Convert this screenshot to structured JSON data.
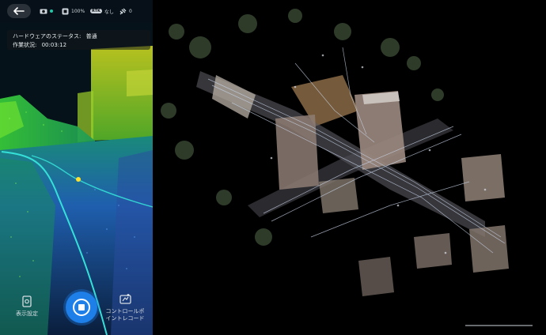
{
  "topbar": {
    "back_icon": "arrow-left-icon",
    "camera_icon": "camera-icon",
    "camera_dot_color": "#1ec9a8",
    "storage_icon": "storage-icon",
    "storage_value": "100%",
    "rtk_badge": "RTK",
    "rtk_value": "なし",
    "satellite_icon": "satellite-icon",
    "satellite_value": "0"
  },
  "status": {
    "hardware_label": "ハードウェアのステータス:",
    "hardware_value": "普通",
    "work_label": "作業状況:",
    "work_value": "00:03:12"
  },
  "bottom": {
    "display_settings_label": "表示設定",
    "control_point_label_line1": "コントロールポ",
    "control_point_label_line2": "イントレコード",
    "record_icon": "stop-record-icon"
  },
  "colors": {
    "accent": "#1e7fe8",
    "trajectory": "#35e0d8",
    "current_position": "#ffe030"
  }
}
